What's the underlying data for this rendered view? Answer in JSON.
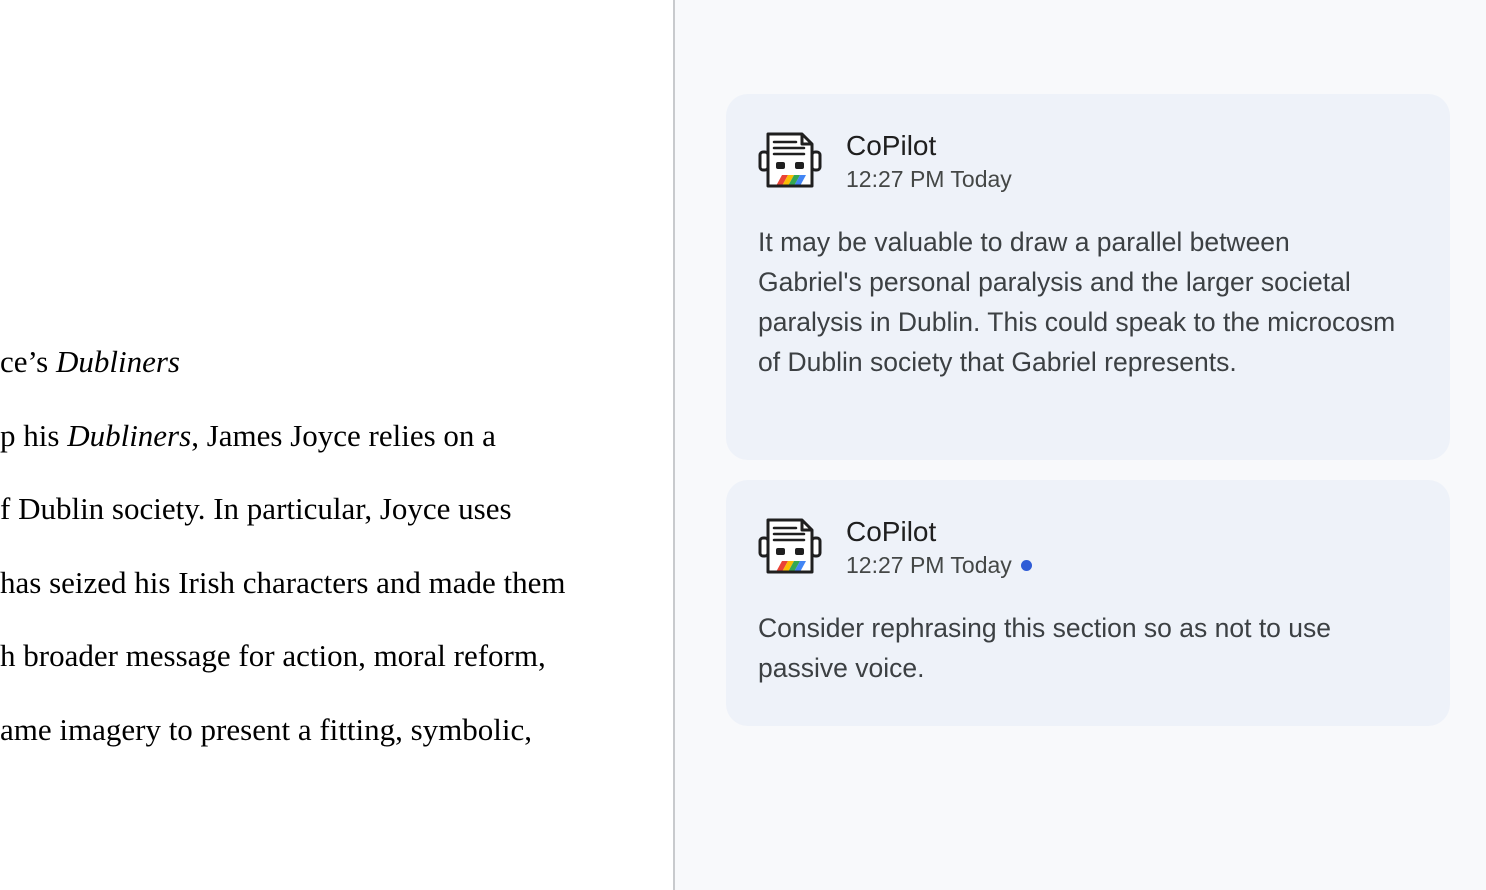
{
  "document": {
    "lines": [
      {
        "segments": [
          {
            "text": "ce’s ",
            "italic": false
          },
          {
            "text": "Dubliners",
            "italic": true
          }
        ]
      },
      {
        "segments": [
          {
            "text": "p his ",
            "italic": false
          },
          {
            "text": "Dubliners",
            "italic": true
          },
          {
            "text": ", James Joyce relies on a",
            "italic": false
          }
        ]
      },
      {
        "segments": [
          {
            "text": "f Dublin society.  In particular, Joyce uses",
            "italic": false
          }
        ]
      },
      {
        "segments": [
          {
            "text": "has seized his Irish characters and made them",
            "italic": false
          }
        ]
      },
      {
        "segments": [
          {
            "text": "h broader message for action, moral reform,",
            "italic": false
          }
        ]
      },
      {
        "segments": [
          {
            "text": "ame imagery to present a fitting, symbolic,",
            "italic": false
          }
        ]
      }
    ]
  },
  "comments": [
    {
      "author": "CoPilot",
      "time": "12:27 PM Today",
      "unread": false,
      "avatar_icon": "robot-document-icon",
      "text": "It may be valuable to draw a parallel between Gabriel's personal paralysis and the larger societal paralysis in Dublin. This could speak to the microcosm of Dublin society that Gabriel represents."
    },
    {
      "author": "CoPilot",
      "time": "12:27 PM Today",
      "unread": true,
      "avatar_icon": "robot-document-icon",
      "text": "Consider rephrasing this section so as not to use passive voice."
    }
  ],
  "colors": {
    "card_background": "#eef2f9",
    "pane_background": "#f8f9fb",
    "unread_dot": "#2f5cd6"
  }
}
